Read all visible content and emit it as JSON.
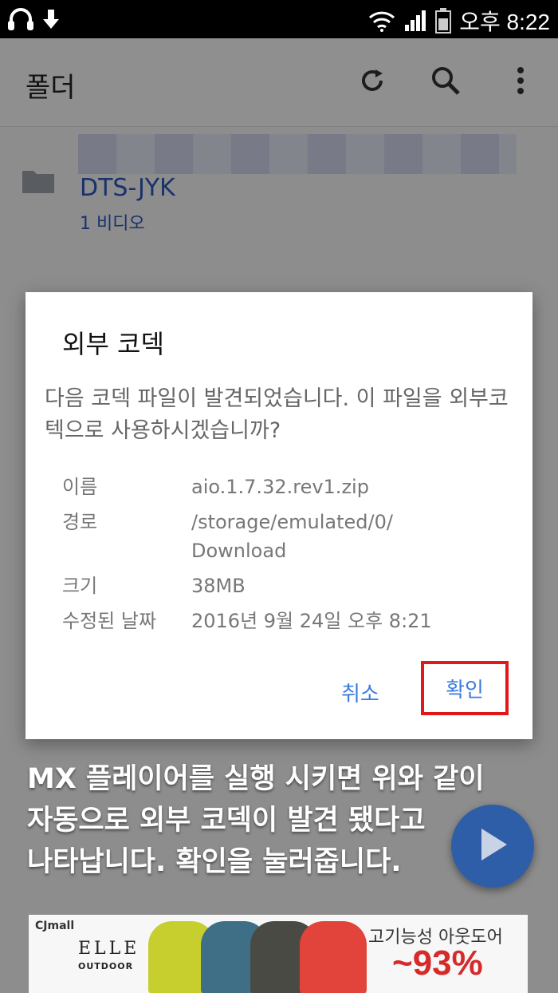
{
  "status_bar": {
    "time": "오후 8:22"
  },
  "app_bar": {
    "title": "폴더"
  },
  "folder": {
    "name": "DTS-JYK",
    "count": "1 비디오"
  },
  "dialog": {
    "title": "외부 코덱",
    "message": "다음 코덱 파일이 발견되었습니다. 이 파일을 외부코텍으로 사용하시겠습니까?",
    "info": [
      {
        "label": "이름",
        "value": "aio.1.7.32.rev1.zip"
      },
      {
        "label": "경로",
        "value": "/storage/emulated/0/\nDownload"
      },
      {
        "label": "크기",
        "value": "38MB"
      },
      {
        "label": "수정된 날짜",
        "value": "2016년 9월 24일 오후 8:21"
      }
    ],
    "cancel_label": "취소",
    "ok_label": "확인"
  },
  "caption": {
    "line1": "MX 플레이어를 실행 시키면 위와 같이",
    "line2": "자동으로 외부 코덱이 발견 됐다고",
    "line3": "나타납니다. 확인을 눌러줍니다."
  },
  "ad": {
    "brand": "CJmall",
    "logo": "ELLE",
    "logo_sub": "OUTDOOR",
    "slogan": "고기능성 아웃도어",
    "discount": "~93%"
  },
  "colors": {
    "accent": "#3c7be0",
    "highlight_box": "#e21818",
    "folder_text": "#2a56b8",
    "fab": "#2f5ea8"
  }
}
